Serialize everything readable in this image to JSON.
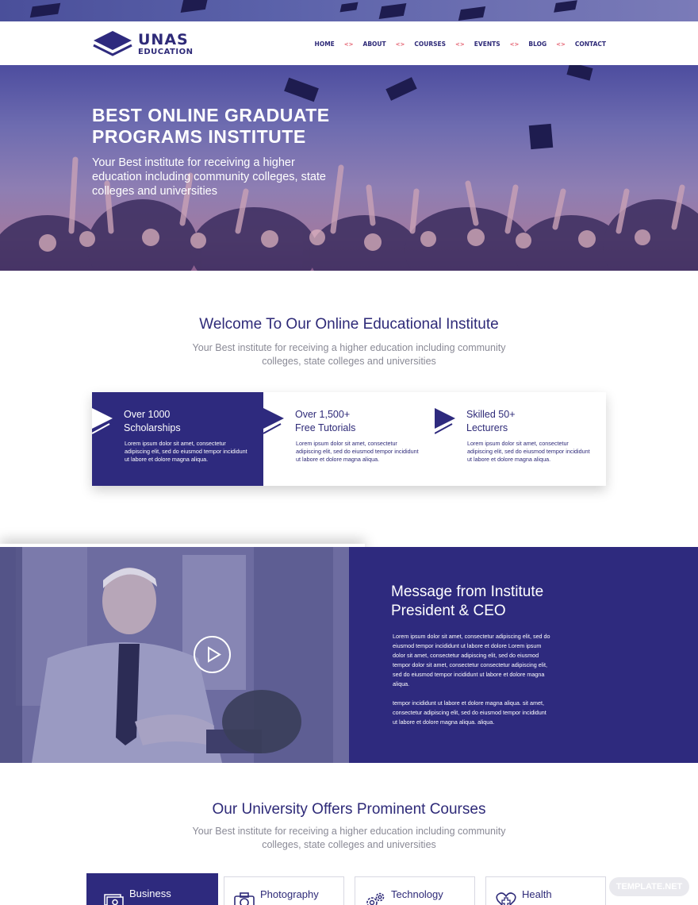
{
  "brand": {
    "name": "UNAS",
    "tagline": "EDUCATION",
    "color": "#2e2a7e",
    "accent": "#e35b6b"
  },
  "nav": {
    "items": [
      "HOME",
      "ABOUT",
      "COURSES",
      "EVENTS",
      "BLOG",
      "CONTACT"
    ],
    "separator": "<>"
  },
  "hero": {
    "title_line1": "BEST ONLINE GRADUATE",
    "title_line2": "PROGRAMS INSTITUTE",
    "subtitle": "Your Best institute for receiving a higher education including community colleges, state colleges and universities"
  },
  "welcome": {
    "title": "Welcome To Our Online Educational Institute",
    "subtitle_line1": "Your Best institute for receiving a higher education including community",
    "subtitle_line2": "colleges, state colleges and universities"
  },
  "features": [
    {
      "title_line1": "Over 1000",
      "title_line2": "Scholarships",
      "text": "Lorem ipsum dolor sit amet, consectetur adipiscing elit, sed do eiusmod tempor incididunt ut labore et dolore magna aliqua."
    },
    {
      "title_line1": "Over 1,500+",
      "title_line2": "Free Tutorials",
      "text": "Lorem ipsum dolor sit amet, consectetur adipiscing elit, sed do eiusmod tempor incididunt ut labore et dolore magna aliqua."
    },
    {
      "title_line1": "Skilled 50+",
      "title_line2": "Lecturers",
      "text": "Lorem ipsum dolor sit amet, consectetur adipiscing elit, sed do eiusmod tempor incididunt ut labore et dolore magna aliqua."
    }
  ],
  "president": {
    "title_line1": "Message from Institute",
    "title_line2": "President & CEO",
    "paragraph1": "Lorem ipsum dolor sit amet, consectetur adipiscing elit, sed do eiusmod tempor incididunt ut labore et dolore Lorem ipsum dolor sit amet, consectetur adipiscing elit, sed do eiusmod tempor dolor sit amet, consectetur consectetur adipiscing elit, sed do eiusmod tempor incididunt ut labore et dolore magna aliqua.",
    "paragraph2": "tempor incididunt ut labore et dolore magna aliqua. sit amet, consectetur adipiscing elit, sed do eiusmod tempor incididunt ut labore et dolore magna aliqua. aliqua."
  },
  "courses": {
    "title": "Our University Offers Prominent Courses",
    "subtitle_line1": "Your Best institute for receiving a higher education including community",
    "subtitle_line2": "colleges, state colleges and universities",
    "tabs": [
      {
        "label": "Business",
        "icon": "money-icon",
        "active": true
      },
      {
        "label": "Photography",
        "icon": "camera-icon",
        "active": false
      },
      {
        "label": "Technology",
        "icon": "gears-icon",
        "active": false
      },
      {
        "label": "Health",
        "icon": "heart-cross-icon",
        "active": false
      }
    ]
  },
  "watermark": "TEMPLATE.NET"
}
